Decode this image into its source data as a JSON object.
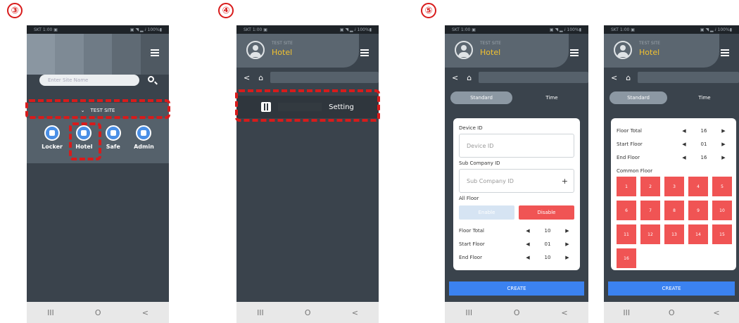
{
  "steps": [
    "③",
    "④",
    "⑤"
  ],
  "status_bar": {
    "left": "SKT 1:00 ▣",
    "right": "▣ ◥ ▂ ⅈ 100%▮"
  },
  "nav_keys": [
    "III",
    "O",
    "<"
  ],
  "screen3": {
    "search_placeholder": "Enter Site Name",
    "site_name": "TEST SITE",
    "apps": [
      "Locker",
      "Hotel",
      "Safe",
      "Admin"
    ],
    "header_blocks": [
      "#8a96a1",
      "#7e8a95",
      "#6f7b86",
      "#5f6a74",
      "#4f5962"
    ]
  },
  "screen4": {
    "header_sub": "TEST SITE",
    "header_title": "Hotel",
    "setting_label": "Setting"
  },
  "screen5a": {
    "header_sub": "TEST SITE",
    "header_title": "Hotel",
    "tabs": [
      "Standard",
      "Time"
    ],
    "device_id_label": "Device ID",
    "device_id_placeholder": "Device ID",
    "sub_company_label": "Sub Company ID",
    "sub_company_placeholder": "Sub Company ID",
    "all_floor_label": "All Floor",
    "all_floor_options": [
      "Enable",
      "Disable"
    ],
    "rows": [
      {
        "label": "Floor Total",
        "value": "10"
      },
      {
        "label": "Start Floor",
        "value": "01"
      },
      {
        "label": "End Floor",
        "value": "10"
      }
    ],
    "create_label": "CREATE"
  },
  "screen5b": {
    "header_sub": "TEST SITE",
    "header_title": "Hotel",
    "tabs": [
      "Standard",
      "Time"
    ],
    "rows": [
      {
        "label": "Floor Total",
        "value": "16"
      },
      {
        "label": "Start Floor",
        "value": "01"
      },
      {
        "label": "End Floor",
        "value": "16"
      }
    ],
    "common_floor_label": "Common Floor",
    "floors": [
      "1",
      "2",
      "3",
      "4",
      "5",
      "6",
      "7",
      "8",
      "9",
      "10",
      "11",
      "12",
      "13",
      "14",
      "15",
      "16"
    ],
    "create_label": "CREATE"
  }
}
